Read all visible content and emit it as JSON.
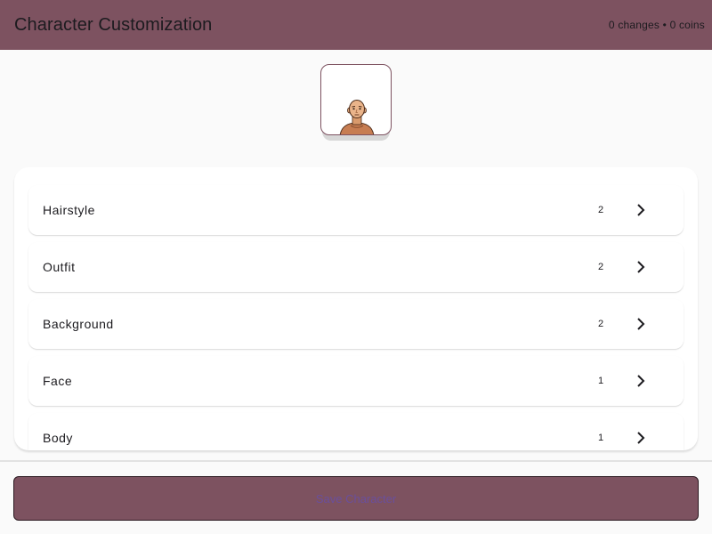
{
  "app_bar": {
    "title": "Character Customization",
    "status": "0 changes • 0 coins",
    "color": "#7d5260"
  },
  "preview": {
    "icon": "character-avatar-icon"
  },
  "categories": [
    {
      "label": "Hairstyle",
      "count": "2"
    },
    {
      "label": "Outfit",
      "count": "2"
    },
    {
      "label": "Background",
      "count": "2"
    },
    {
      "label": "Face",
      "count": "1"
    },
    {
      "label": "Body",
      "count": "1"
    }
  ],
  "footer": {
    "button_label": "Save Character"
  }
}
